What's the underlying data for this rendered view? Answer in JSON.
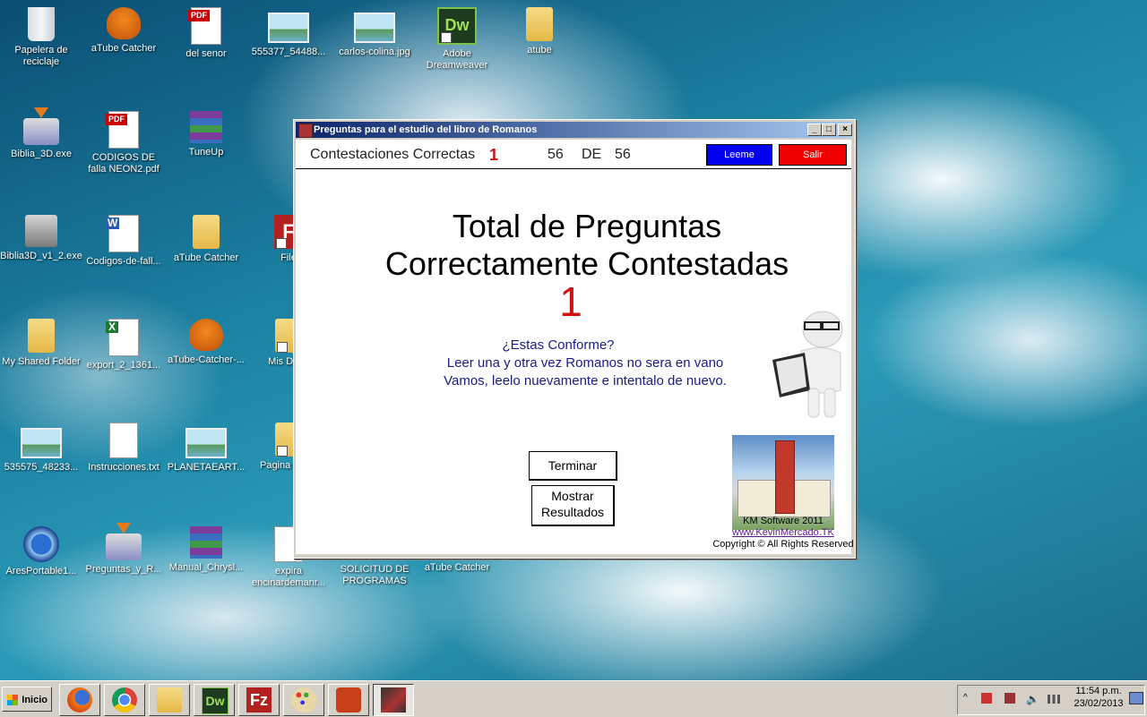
{
  "desktop": {
    "icons": [
      {
        "label": "Papelera de reciclaje",
        "icon": "recycle-bin-icon"
      },
      {
        "label": "aTube Catcher",
        "icon": "atube-catcher-icon"
      },
      {
        "label": "del senor",
        "icon": "pdf-icon"
      },
      {
        "label": "555377_54488...",
        "icon": "image-file-icon"
      },
      {
        "label": "carlos-colina.jpg",
        "icon": "image-file-icon"
      },
      {
        "label": "Adobe Dreamweaver",
        "icon": "dreamweaver-icon"
      },
      {
        "label": "atube",
        "icon": "folder-icon"
      },
      {
        "label": "Biblia_3D.exe",
        "icon": "installer-icon"
      },
      {
        "label": "CODIGOS DE falla NEON2.pdf",
        "icon": "pdf-icon"
      },
      {
        "label": "TuneUp",
        "icon": "winrar-icon"
      },
      {
        "label": "Biblia3D_v1_2.exe",
        "icon": "setup-computer-icon"
      },
      {
        "label": "Codigos-de-fall...",
        "icon": "word-document-icon"
      },
      {
        "label": "aTube Catcher",
        "icon": "folder-icon"
      },
      {
        "label": "File",
        "icon": "filezilla-icon"
      },
      {
        "label": "My Shared Folder",
        "icon": "folder-icon"
      },
      {
        "label": "export_2_1361...",
        "icon": "excel-file-icon"
      },
      {
        "label": "aTube-Catcher-...",
        "icon": "atube-catcher-icon"
      },
      {
        "label": "Mis Docu",
        "icon": "folder-icon"
      },
      {
        "label": "535575_48233...",
        "icon": "image-file-icon"
      },
      {
        "label": "Instrucciones.txt",
        "icon": "text-file-icon"
      },
      {
        "label": "PLANETAEART...",
        "icon": "image-file-icon"
      },
      {
        "label": "Pagina Temp",
        "icon": "folder-icon"
      },
      {
        "label": "AresPortable1...",
        "icon": "ares-icon"
      },
      {
        "label": "Preguntas_y_R...",
        "icon": "installer-icon"
      },
      {
        "label": "Manual_Chrysl...",
        "icon": "winrar-icon"
      },
      {
        "label": "expira encinardemanr...",
        "icon": "text-file-icon"
      },
      {
        "label": "SOLICITUD DE PROGRAMAS",
        "icon": "folder-icon"
      },
      {
        "label": "aTube Catcher",
        "icon": "atube-catcher-icon"
      }
    ]
  },
  "window": {
    "title": "Preguntas para el estudio del libro de Romanos",
    "controls": {
      "minimize": "_",
      "maximize": "□",
      "close": "×"
    },
    "topbar": {
      "label": "Contestaciones Correctas",
      "correct_count": "1",
      "current": "56",
      "de": "DE",
      "total": "56",
      "leeme_label": "Leeme",
      "salir_label": "Salir",
      "leeme_color": "#0000ee",
      "salir_color": "#ee0000"
    },
    "heading_line1": "Total de Preguntas",
    "heading_line2": "Correctamente Contestadas",
    "score": "1",
    "message_line1": "¿Estas Conforme?",
    "message_line2": "Leer una y otra vez Romanos no sera en vano",
    "message_line3": "Vamos, leelo nuevamente e intentalo de nuevo.",
    "terminar_label": "Terminar",
    "mostrar_label_line1": "Mostrar",
    "mostrar_label_line2": "Resultados",
    "credits": {
      "line1": "KM Software 2011",
      "link": "www.KevinMercado.TK",
      "line3": "Copyright © All Rights Reserved"
    }
  },
  "taskbar": {
    "start_label": "Inicio",
    "apps": [
      "firefox-icon",
      "chrome-icon",
      "file-explorer-icon",
      "dreamweaver-icon",
      "filezilla-icon",
      "paint-icon",
      "presentation-icon",
      "romanos-app-icon"
    ],
    "clock_time": "11:54 p.m.",
    "clock_date": "23/02/2013"
  }
}
